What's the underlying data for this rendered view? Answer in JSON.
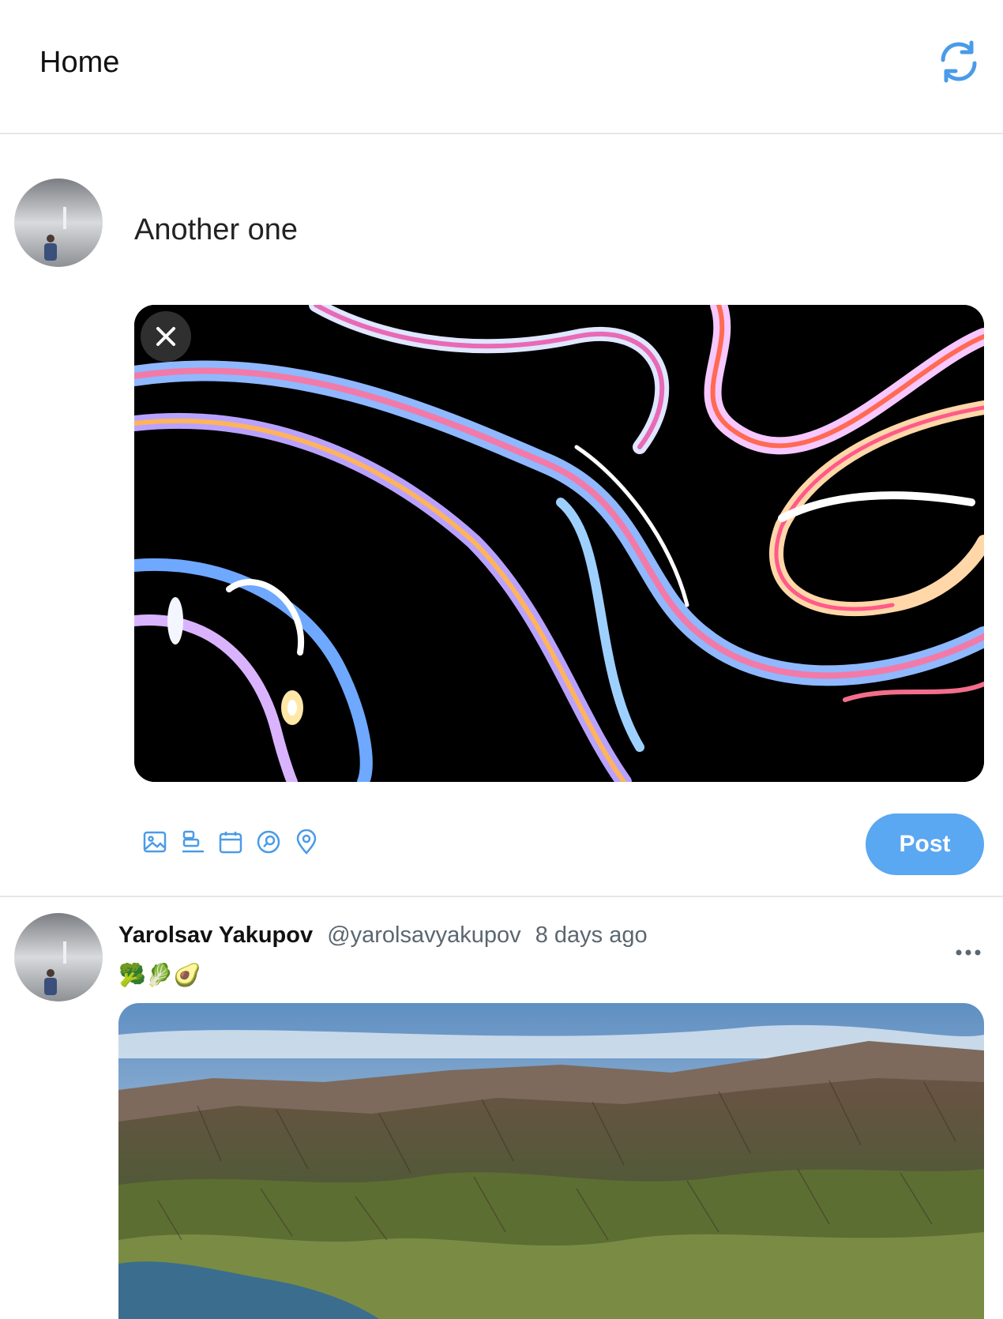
{
  "header": {
    "title": "Home",
    "refresh_icon": "refresh-icon",
    "accent": "#4a9be8"
  },
  "composer": {
    "avatar_icon": "user-avatar",
    "text": "Another one",
    "media_alt": "abstract-swirl-image",
    "close_icon": "close-icon",
    "tools": [
      "image-icon",
      "poll-icon",
      "calendar-icon",
      "search-icon",
      "location-icon"
    ],
    "post_label": "Post",
    "post_color": "#5aa7f2"
  },
  "feed": {
    "posts": [
      {
        "name": "Yarolsav Yakupov",
        "handle": "@yarolsavyakupov",
        "time": "8 days ago",
        "text": "🥦🥬🥑",
        "more_icon": "more-icon",
        "image": "mountain-landscape-photo"
      }
    ]
  }
}
